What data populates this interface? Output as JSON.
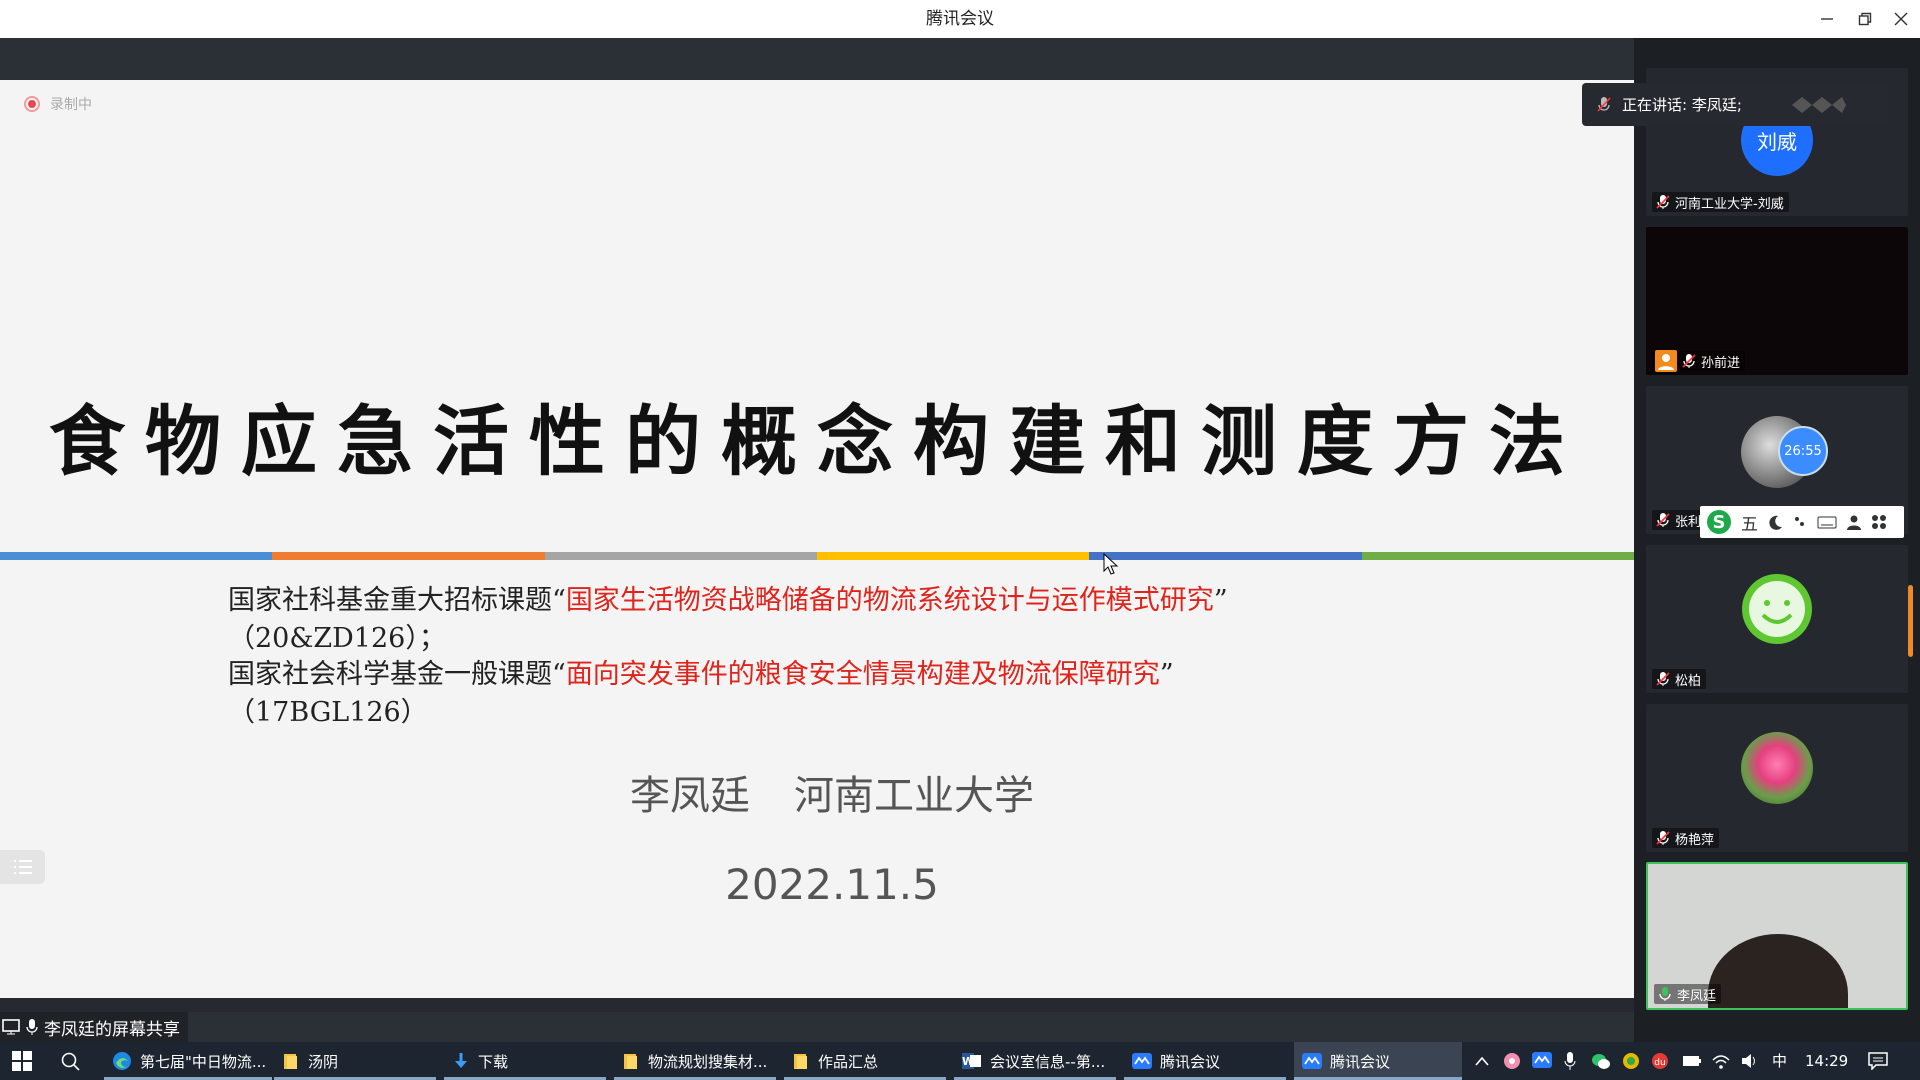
{
  "window": {
    "title": "腾讯会议"
  },
  "recording": {
    "label": "录制中"
  },
  "speaking": {
    "text": "正在讲话: 李凤廷;"
  },
  "slide": {
    "title": "食物应急活性的概念构建和测度方法",
    "colorbar": [
      "#4a8fd6",
      "#ef7d31",
      "#a5a5a5",
      "#ffc000",
      "#4472c4",
      "#70ad47"
    ],
    "lines": [
      {
        "prefix": "国家社科基金重大招标课题“",
        "red": "国家生活物资战略储备的物流系统设计与运作模式研究",
        "suffix": "”"
      },
      {
        "prefix": "（20&ZD126）；",
        "red": "",
        "suffix": ""
      },
      {
        "prefix": "国家社会科学基金一般课题“",
        "red": "面向突发事件的粮食安全情景构建及物流保障研究",
        "suffix": "”"
      },
      {
        "prefix": "（17BGL126）",
        "red": "",
        "suffix": ""
      }
    ],
    "author": "李凤廷",
    "affiliation": "河南工业大学",
    "date": "2022.11.5"
  },
  "participants": [
    {
      "name": "河南工业大学-刘威",
      "avatar_text": "刘威",
      "avatar_color": "#1e6fff"
    },
    {
      "name": "孙前进"
    },
    {
      "name": "张利",
      "timer": "26:55"
    },
    {
      "name": "松柏"
    },
    {
      "name": "杨艳萍"
    },
    {
      "name": "李凤廷"
    }
  ],
  "ime_toolbar": {
    "label": "五"
  },
  "share": {
    "label": "李凤廷的屏幕共享"
  },
  "taskbar": {
    "items": [
      {
        "label": "第七届\"中日物流...",
        "icon": "edge-icon"
      },
      {
        "label": "汤阴",
        "icon": "folder-icon"
      },
      {
        "label": "下载",
        "icon": "download-icon"
      },
      {
        "label": "物流规划搜集材...",
        "icon": "folder-icon"
      },
      {
        "label": "作品汇总",
        "icon": "folder-icon"
      },
      {
        "label": "会议室信息--第...",
        "icon": "word-icon"
      },
      {
        "label": "腾讯会议",
        "icon": "tencent-meeting-icon"
      },
      {
        "label": "腾讯会议",
        "icon": "tencent-meeting-icon"
      }
    ],
    "ime": "中",
    "clock": "14:29"
  }
}
